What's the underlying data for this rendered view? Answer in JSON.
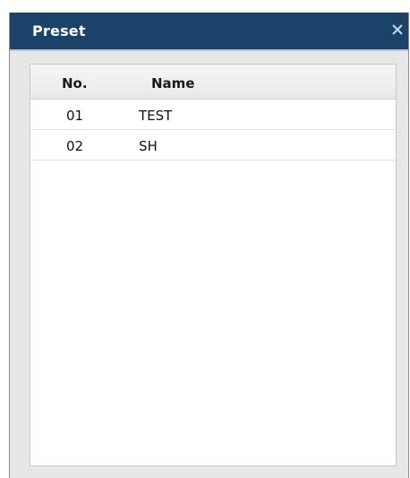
{
  "dialog": {
    "title": "Preset",
    "close_icon": "close-icon"
  },
  "table": {
    "columns": [
      "No.",
      "Name"
    ],
    "rows": [
      {
        "no": "01",
        "name": "TEST"
      },
      {
        "no": "02",
        "name": "SH"
      }
    ]
  },
  "colors": {
    "titlebar": "#1b4369",
    "title_text": "#ffffff",
    "dialog_bg": "#e7e7e7",
    "panel_bg": "#ffffff"
  }
}
